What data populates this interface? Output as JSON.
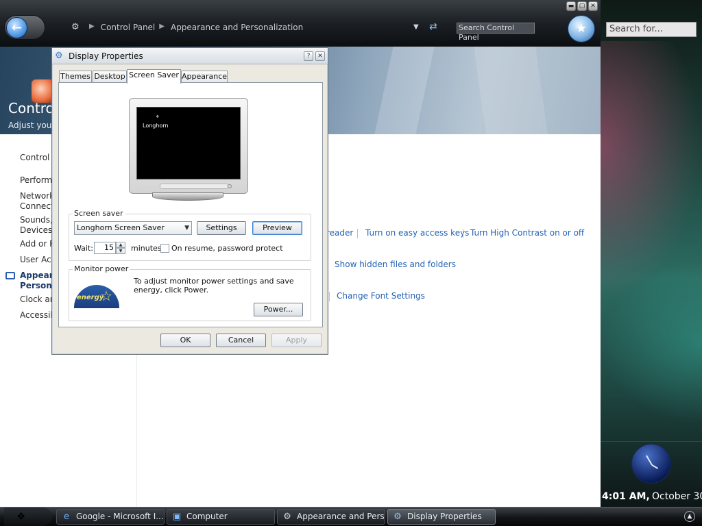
{
  "control_panel": {
    "breadcrumbs": [
      "Control Panel",
      "Appearance and Personalization"
    ],
    "search_placeholder": "Search Control Panel",
    "header_title": "Contro",
    "header_subtitle": "Adjust your",
    "sidebar": [
      {
        "label": "Control P"
      },
      {
        "label": "Performa"
      },
      {
        "label": "Network"
      },
      {
        "label": "Connect"
      },
      {
        "label": "Sounds,"
      },
      {
        "label": "Devices"
      },
      {
        "label": "Add or R"
      },
      {
        "label": "User Acc"
      },
      {
        "label": "Appeara"
      },
      {
        "label": "Personal"
      },
      {
        "label": "Clock an"
      },
      {
        "label": "Accessib"
      }
    ],
    "links": {
      "reader": "reader",
      "easy_access_keys": "Turn on easy access keys",
      "high_contrast": "Turn High Contrast on or off",
      "hidden_files": "Show hidden files and folders",
      "font_settings": "Change Font Settings"
    }
  },
  "window_controls": {
    "minimize": "▬",
    "maximize": "▢",
    "close": "✕"
  },
  "dialog": {
    "title": "Display Properties",
    "help": "?",
    "close": "✕",
    "tabs": [
      {
        "label": "Themes"
      },
      {
        "label": "Desktop"
      },
      {
        "label": "Screen Saver"
      },
      {
        "label": "Appearance"
      }
    ],
    "active_tab": "Screen Saver",
    "preview_text": "Longhorn",
    "screen_saver": {
      "group_label": "Screen saver",
      "selected": "Longhorn Screen Saver",
      "settings_label": "Settings",
      "preview_label": "Preview",
      "wait_label": "Wait:",
      "wait_value": "15",
      "minutes_label": "minutes",
      "password_label": "On resume, password protect",
      "password_checked": false
    },
    "monitor_power": {
      "group_label": "Monitor power",
      "logo_text": "energy",
      "text": "To adjust monitor power settings and save energy, click Power.",
      "power_label": "Power..."
    },
    "ok_label": "OK",
    "cancel_label": "Cancel",
    "apply_label": "Apply"
  },
  "vista_sidebar": {
    "search_placeholder": "Search for...",
    "time": "4:01 AM,",
    "date": "October 30"
  },
  "taskbar": {
    "items": [
      {
        "label": "Google - Microsoft I..."
      },
      {
        "label": "Computer"
      },
      {
        "label": "Appearance and Pers..."
      },
      {
        "label": "Display Properties"
      }
    ],
    "active": "Display Properties"
  }
}
